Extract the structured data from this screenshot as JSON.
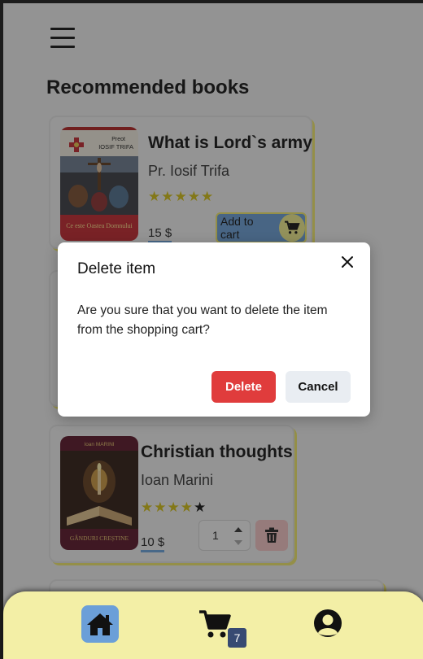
{
  "page": {
    "section_title": "Recommended books"
  },
  "books": [
    {
      "title": "What is Lord`s army",
      "author": "Pr. Iosif Trifa",
      "rating": 5,
      "rating_max": 5,
      "price": "15 $",
      "cover_top_text_1": "Preot",
      "cover_top_text_2": "IOSIF TRIFA",
      "cover_bottom_text": "Ce este Oastea Domnului",
      "add_to_cart_label": "Add to cart"
    },
    {
      "title": "Christian thoughts",
      "author": "Ioan Marini",
      "rating": 4,
      "rating_max": 5,
      "price": "10 $",
      "cover_top_text": "Ioan MARINI",
      "cover_bottom_text": "GÂNDURI CREȘTINE",
      "quantity": "1"
    }
  ],
  "modal": {
    "title": "Delete item",
    "body": "Are you sure that you want to delete the item from the shopping cart?",
    "confirm_label": "Delete",
    "cancel_label": "Cancel"
  },
  "nav": {
    "cart_count": "7"
  },
  "colors": {
    "accent_blue": "#6b9fd8",
    "accent_yellow": "#f5ec6b",
    "danger": "#e03c3c",
    "nav_bg": "#f3efa6"
  }
}
